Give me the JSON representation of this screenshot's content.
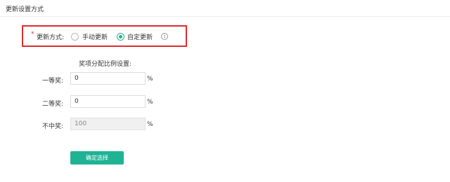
{
  "header": {
    "title": "更新设置方式"
  },
  "update_method": {
    "required_mark": "*",
    "label": "更新方式:",
    "options": [
      {
        "label": "手动更新",
        "selected": false
      },
      {
        "label": "自定更新",
        "selected": true
      }
    ],
    "info_icon": "info-icon",
    "highlight_color": "#e02b2b"
  },
  "ratio": {
    "section_title": "奖项分配比例设置:",
    "rows": [
      {
        "label": "一等奖:",
        "value": "0",
        "unit": "%",
        "disabled": false
      },
      {
        "label": "二等奖:",
        "value": "0",
        "unit": "%",
        "disabled": false
      },
      {
        "label": "不中奖:",
        "value": "100",
        "unit": "%",
        "disabled": true
      }
    ]
  },
  "actions": {
    "confirm_label": "确定选择"
  },
  "colors": {
    "accent": "#1fb394",
    "radio_selected": "#23b28c",
    "required": "#e0312f"
  }
}
